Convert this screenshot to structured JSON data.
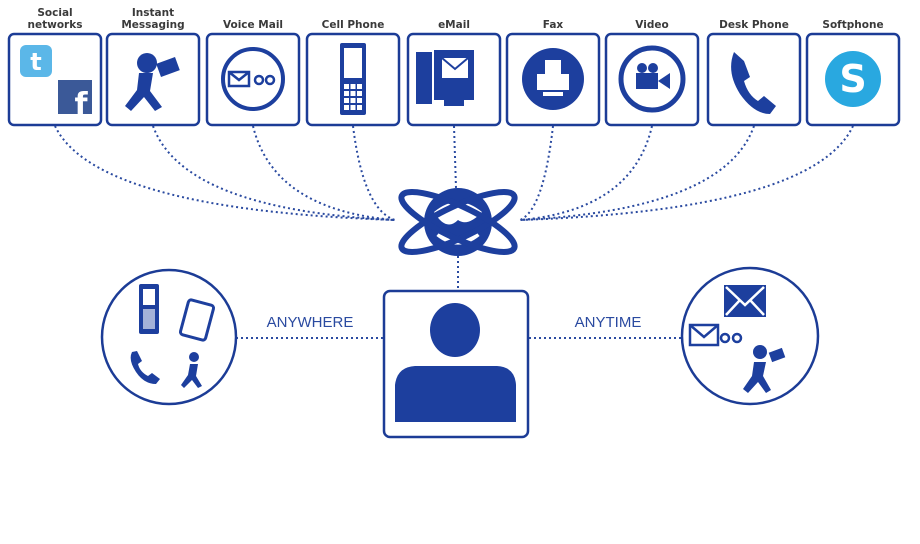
{
  "channels": [
    {
      "label_line1": "Social",
      "label_line2": "networks",
      "icon": "twitter-facebook-icon"
    },
    {
      "label_line1": "Instant",
      "label_line2": "Messaging",
      "icon": "running-messenger-icon"
    },
    {
      "label_line1": "",
      "label_line2": "Voice Mail",
      "icon": "voicemail-icon"
    },
    {
      "label_line1": "",
      "label_line2": "Cell Phone",
      "icon": "cell-phone-icon"
    },
    {
      "label_line1": "",
      "label_line2": "eMail",
      "icon": "email-computer-icon"
    },
    {
      "label_line1": "",
      "label_line2": "Fax",
      "icon": "fax-icon"
    },
    {
      "label_line1": "",
      "label_line2": "Video",
      "icon": "video-camera-icon"
    },
    {
      "label_line1": "",
      "label_line2": "Desk Phone",
      "icon": "desk-phone-icon"
    },
    {
      "label_line1": "",
      "label_line2": "Softphone",
      "icon": "skype-icon"
    }
  ],
  "hub_icon": "globe-orbit-icon",
  "center_icon": "user-icon",
  "left": {
    "label": "ANYWHERE",
    "icon": "devices-icon"
  },
  "right": {
    "label": "ANYTIME",
    "icon": "messages-icon"
  },
  "colors": {
    "primary": "#1d3f9e",
    "twitter": "#5bb7e8",
    "facebook": "#3b5998",
    "skype": "#29a8e0"
  },
  "brand_marks": {
    "twitter": "t",
    "facebook": "f",
    "skype": "S"
  }
}
